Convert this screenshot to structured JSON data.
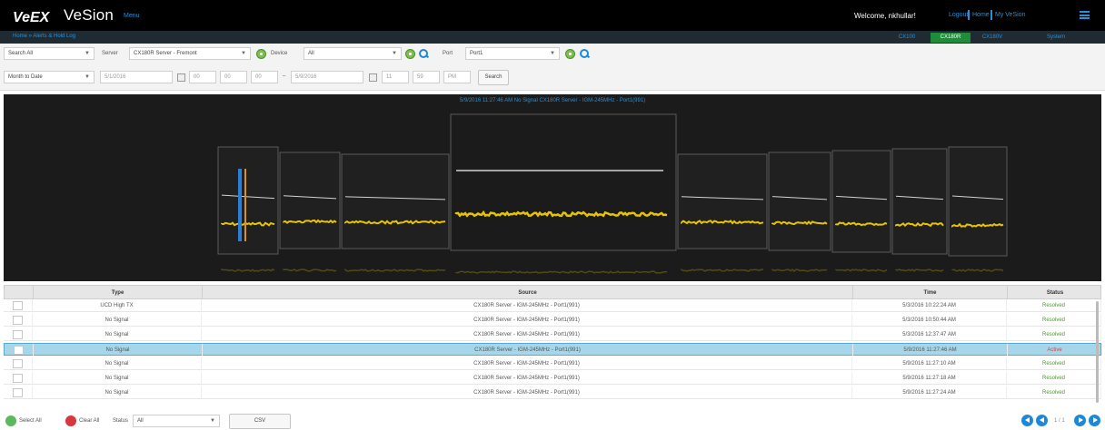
{
  "header": {
    "app_name": "VeSion",
    "logo_text": "VeEX",
    "menu_label": "Menu",
    "welcome": "Welcome, nkhullar!",
    "logout": "Logout",
    "home": "Home",
    "my_vesion": "My VeSion"
  },
  "nav": {
    "breadcrumb": "Home » Alerts & Hold Log",
    "tabs": [
      {
        "label": "CX100",
        "active": false
      },
      {
        "label": "CX180R",
        "active": true
      },
      {
        "label": "CX180V",
        "active": false
      },
      {
        "label": "System",
        "active": false
      }
    ]
  },
  "filters": {
    "search_scope": "Search All",
    "server_label": "Server",
    "server_value": "CX180R Server - Fremont",
    "device_label": "Device",
    "device_value": "All",
    "port_label": "Port",
    "port_value": "Port1",
    "period": "Month to Date",
    "start_date": "5/1/2016",
    "start_h": "00",
    "start_m": "00",
    "start_ampm": "00",
    "end_date": "5/9/2016",
    "end_h": "11",
    "end_m": "59",
    "end_ampm": "PM",
    "search_button": "Search"
  },
  "chart": {
    "title": "5/9/2016 11:27:46 AM No Signal CX180R Server - IGM-245MHz - Port1(991)",
    "colors": {
      "trace": "#e8c400",
      "limit": "#cfd4d8",
      "frame": "#5a5a5a"
    }
  },
  "table": {
    "columns": [
      "Type",
      "Source",
      "Time",
      "Status"
    ],
    "rows": [
      {
        "type": "UCD High TX",
        "source": "CX180R Server - IGM-245MHz - Port1(991)",
        "time": "5/3/2016 10:22:24 AM",
        "status": "Resolved",
        "selected": false
      },
      {
        "type": "No Signal",
        "source": "CX180R Server - IGM-245MHz - Port1(991)",
        "time": "5/3/2016 10:50:44 AM",
        "status": "Resolved",
        "selected": false
      },
      {
        "type": "No Signal",
        "source": "CX180R Server - IGM-245MHz - Port1(991)",
        "time": "5/3/2016 12:37:47 AM",
        "status": "Resolved",
        "selected": false
      },
      {
        "type": "No Signal",
        "source": "CX180R Server - IGM-245MHz - Port1(991)",
        "time": "5/9/2016 11:27:46 AM",
        "status": "Active",
        "selected": true
      },
      {
        "type": "No Signal",
        "source": "CX180R Server - IGM-245MHz - Port1(991)",
        "time": "5/9/2016 11:27:10 AM",
        "status": "Resolved",
        "selected": false
      },
      {
        "type": "No Signal",
        "source": "CX180R Server - IGM-245MHz - Port1(991)",
        "time": "5/9/2016 11:27:18 AM",
        "status": "Resolved",
        "selected": false
      },
      {
        "type": "No Signal",
        "source": "CX180R Server - IGM-245MHz - Port1(991)",
        "time": "5/9/2016 11:27:24 AM",
        "status": "Resolved",
        "selected": false
      }
    ]
  },
  "footer": {
    "select_all": "Select All",
    "clear_all": "Clear All",
    "status_label": "Status",
    "status_value": "All",
    "csv": "CSV",
    "page": "1 / 1"
  }
}
